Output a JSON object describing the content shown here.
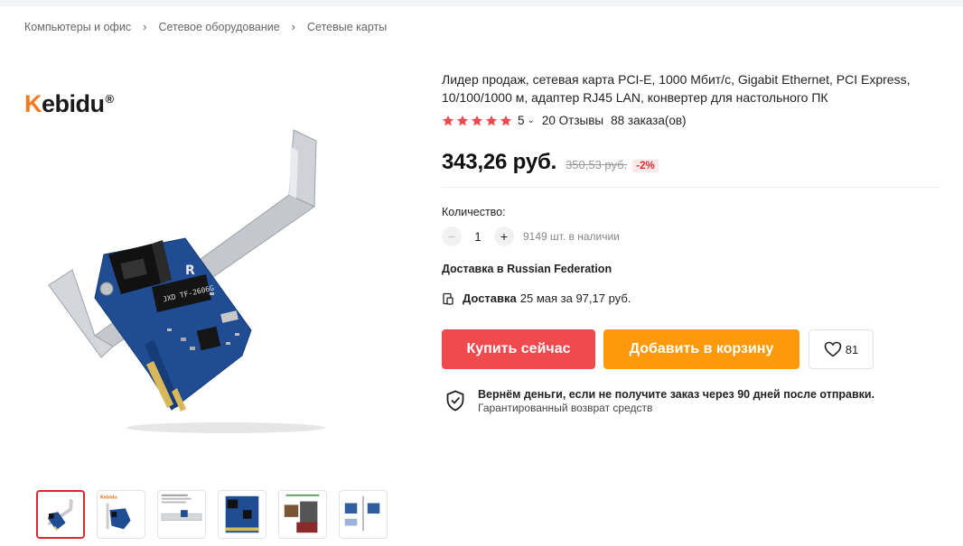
{
  "breadcrumb": [
    "Компьютеры и офис",
    "Сетевое оборудование",
    "Сетевые карты"
  ],
  "brand": {
    "logo_first_letter": "K",
    "logo_rest": "ebidu",
    "logo_mark": "®"
  },
  "product": {
    "title": "Лидер продаж, сетевая карта PCI-E, 1000 Мбит/с, Gigabit Ethernet, PCI Express, 10/100/1000 м, адаптер RJ45 LAN, конвертер для настольного ПК",
    "rating_value": "5",
    "rating_stars": 5,
    "reviews": "20 Отзывы",
    "orders": "88 заказа(ов)",
    "price": "343,26 руб.",
    "old_price": "350,53 руб.",
    "discount": "-2%"
  },
  "quantity": {
    "label": "Количество:",
    "value": "1",
    "minus_label": "−",
    "plus_label": "+",
    "stock": "9149 шт. в наличии"
  },
  "shipping": {
    "ship_to": "Доставка в Russian Federation",
    "delivery_bold": "Доставка",
    "delivery_rest": "25 мая за 97,17 руб."
  },
  "actions": {
    "buy_now": "Купить сейчас",
    "add_to_cart": "Добавить в корзину",
    "wishlist_count": "81"
  },
  "guarantee": {
    "line1": "Вернём деньги, если не получите заказ через 90 дней после отправки.",
    "line2": "Гарантированный возврат средств"
  },
  "colors": {
    "accent_red": "#f04a4f",
    "accent_orange": "#fd9a0b",
    "star": "#f04a4f"
  },
  "icons": [
    "chevron-right-icon",
    "star-icon",
    "chevron-down-icon",
    "calendar-icon",
    "heart-icon",
    "shield-check-icon"
  ]
}
